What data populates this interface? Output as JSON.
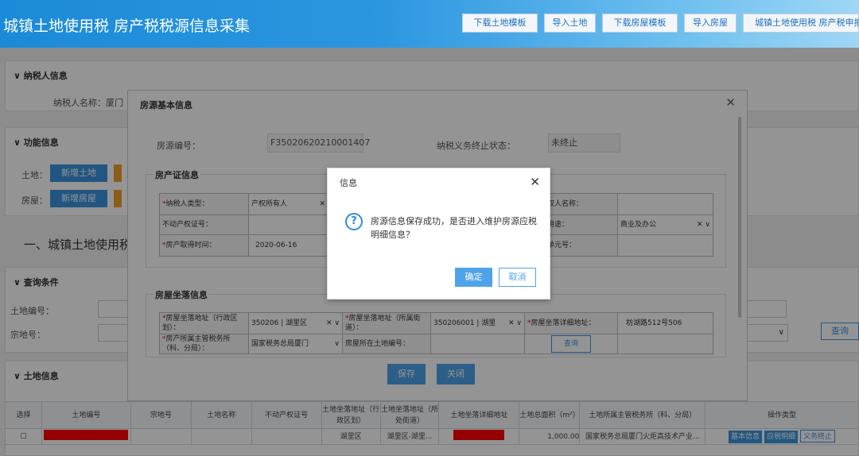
{
  "header": {
    "title": "城镇土地使用税 房产税税源信息采集",
    "buttons": [
      "下载土地模板",
      "导入土地",
      "下载房屋模板",
      "导入房屋",
      "城镇土地使用税 房产税申报"
    ]
  },
  "taxpayer": {
    "section": "纳税人信息",
    "name_label": "纳税人名称：厦门"
  },
  "func": {
    "section": "功能信息",
    "land_label": "土地：",
    "land_btn": "新增土地",
    "house_label": "房屋：",
    "house_btn": "新增房屋"
  },
  "heading": "一、城镇土地使用税",
  "query": {
    "section": "查询条件",
    "land_no_label": "土地编号：",
    "parcel_label": "宗地号：",
    "search": "查询"
  },
  "land": {
    "section": "土地信息",
    "columns": [
      "选择",
      "土地编号",
      "宗地号",
      "土地名称",
      "不动产权证号",
      "土地坐落地址（行政区划）",
      "土地坐落地址（所处街道）",
      "土地坐落详细地址",
      "土地总面积（m²）",
      "土地所属主管税务所（科、分局）",
      "操作类型"
    ],
    "row": {
      "district": "湖里区",
      "street": "湖里区-湖里...",
      "area": "1,000.00",
      "office": "国家税务总局厦门火炬高技术产业...",
      "ops": [
        "基本信息",
        "应税明细",
        "义务终止"
      ]
    }
  },
  "modal": {
    "title": "房源基本信息",
    "house_no_label": "房源编号：",
    "house_no": "F35020620210001407",
    "status_label": "纳税义务终止状态：",
    "status": "未终止",
    "cert_section": "房产证信息",
    "cert": {
      "taxpayer_type_label": "纳税人类型：",
      "taxpayer_type": "产权所有人",
      "right_no_label": "不动产权证号：",
      "acquire_label": "房产取得时间：",
      "acquire_date": "2020-06-16",
      "owner_label": "权人名称：",
      "use_label": "用途：",
      "use": "商业及办公",
      "unit_label": "单元号："
    },
    "loc_section": "房屋坐落信息",
    "loc": {
      "district_label": "房屋坐落地址（行政区划）：",
      "district": "350206 | 湖里区",
      "street_label": "房屋坐落地址（所属街道）：",
      "street": "350206001 | 湖里",
      "detail_label": "房屋坐落详细地址：",
      "detail": "枋湖路512号506",
      "office_label": "房产所属主管税务所（科、分局）：",
      "office": "国家税务总局厦门",
      "land_no_label": "房屋所在土地编号：",
      "query": "查询"
    },
    "save": "保存",
    "close": "关闭"
  },
  "dialog": {
    "title": "信息",
    "message": "房源信息保存成功，是否进入维护房源应税明细信息？",
    "ok": "确定",
    "cancel": "取消"
  }
}
